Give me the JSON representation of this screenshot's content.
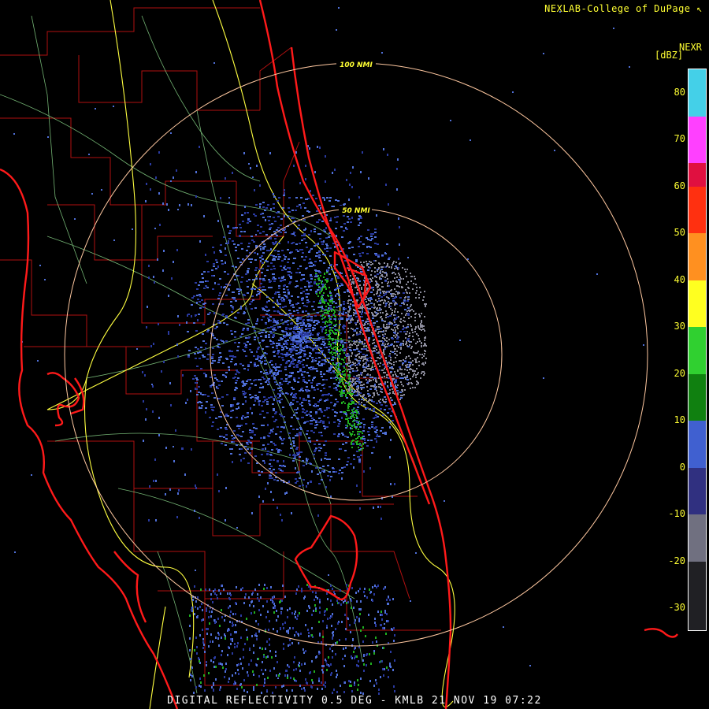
{
  "credit": "NEXLAB-College of DuPage",
  "credit_icon": "cursor-arrow-icon",
  "product_line": "DIGITAL REFLECTIVITY 0.5 DEG - KMLB 21 NOV 19 07:22",
  "range_rings": [
    {
      "label": "50 NMI",
      "range_nmi": 50
    },
    {
      "label": "100 NMI",
      "range_nmi": 100
    }
  ],
  "legend": {
    "title": "NEXR",
    "unit": "[dBZ]",
    "ticks": [
      "80",
      "70",
      "60",
      "50",
      "40",
      "30",
      "20",
      "10",
      "0",
      "-10",
      "-20",
      "-30"
    ],
    "min_dbz": -35,
    "max_dbz": 85,
    "colors": [
      {
        "from": 75,
        "to": 85,
        "color": "#44d0e8"
      },
      {
        "from": 65,
        "to": 75,
        "color": "#ff40ff"
      },
      {
        "from": 60,
        "to": 65,
        "color": "#e01040"
      },
      {
        "from": 50,
        "to": 60,
        "color": "#ff3010"
      },
      {
        "from": 40,
        "to": 50,
        "color": "#ff9020"
      },
      {
        "from": 30,
        "to": 40,
        "color": "#ffff20"
      },
      {
        "from": 20,
        "to": 30,
        "color": "#30d030"
      },
      {
        "from": 10,
        "to": 20,
        "color": "#108010"
      },
      {
        "from": 0,
        "to": 10,
        "color": "#4060d0"
      },
      {
        "from": -10,
        "to": 0,
        "color": "#303080"
      },
      {
        "from": -20,
        "to": -10,
        "color": "#707080"
      },
      {
        "from": -35,
        "to": -20,
        "color": "#202024"
      }
    ]
  },
  "colors": {
    "coastline": "#ff1a1a",
    "county_lines": "#b01010",
    "highways": "#ffff40",
    "minor_roads": "#90e090",
    "range_rings": "#ffc8a0",
    "echo_light": "#5070d8",
    "echo_dark": "#2a3aa0",
    "echo_green": "#20b020",
    "echo_gray": "#8c8c9c"
  }
}
